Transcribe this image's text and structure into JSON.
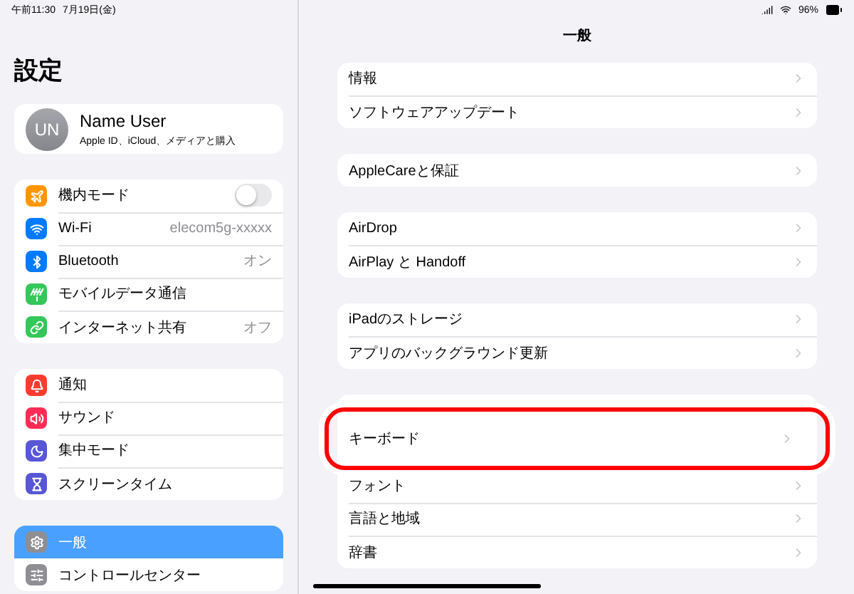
{
  "status_bar": {
    "time": "午前11:30",
    "date": "7月19日(金)",
    "battery": "96%"
  },
  "sidebar": {
    "title": "設定",
    "profile": {
      "initials": "UN",
      "name": "Name User",
      "subtitle": "Apple ID、iCloud、メディアと購入"
    },
    "groups": [
      [
        {
          "kind": "toggle",
          "label": "機内モード",
          "color": "#ff9500",
          "on": false,
          "selected": false
        },
        {
          "kind": "value",
          "label": "Wi-Fi",
          "value": "elecom5g-xxxxx",
          "color": "#007aff",
          "selected": false
        },
        {
          "kind": "value",
          "label": "Bluetooth",
          "value": "オン",
          "color": "#007aff",
          "selected": false
        },
        {
          "kind": "plain",
          "label": "モバイルデータ通信",
          "color": "#34c759",
          "selected": false
        },
        {
          "kind": "value",
          "label": "インターネット共有",
          "value": "オフ",
          "color": "#34c759",
          "selected": false
        }
      ],
      [
        {
          "kind": "plain",
          "label": "通知",
          "color": "#ff3b30",
          "selected": false
        },
        {
          "kind": "plain",
          "label": "サウンド",
          "color": "#ff2d55",
          "selected": false
        },
        {
          "kind": "plain",
          "label": "集中モード",
          "color": "#5856d6",
          "selected": false
        },
        {
          "kind": "plain",
          "label": "スクリーンタイム",
          "color": "#5856d6",
          "selected": false
        }
      ],
      [
        {
          "kind": "plain",
          "label": "一般",
          "color": "#8e8e93",
          "selected": true
        },
        {
          "kind": "plain",
          "label": "コントロールセンター",
          "color": "#8e8e93",
          "selected": false
        }
      ]
    ]
  },
  "detail": {
    "title": "一般",
    "groups": [
      [
        {
          "label": "情報",
          "highlighted": false
        },
        {
          "label": "ソフトウェアアップデート",
          "highlighted": false
        }
      ],
      [
        {
          "label": "AppleCareと保証",
          "highlighted": false
        }
      ],
      [
        {
          "label": "AirDrop",
          "highlighted": false
        },
        {
          "label": "AirPlay と Handoff",
          "highlighted": false
        }
      ],
      [
        {
          "label": "iPadのストレージ",
          "highlighted": false
        },
        {
          "label": "アプリのバックグラウンド更新",
          "highlighted": false
        }
      ],
      [
        {
          "label": "キーボード",
          "highlighted": true
        },
        {
          "label": "フォント",
          "highlighted": false
        },
        {
          "label": "言語と地域",
          "highlighted": false
        },
        {
          "label": "辞書",
          "highlighted": false
        }
      ]
    ]
  }
}
